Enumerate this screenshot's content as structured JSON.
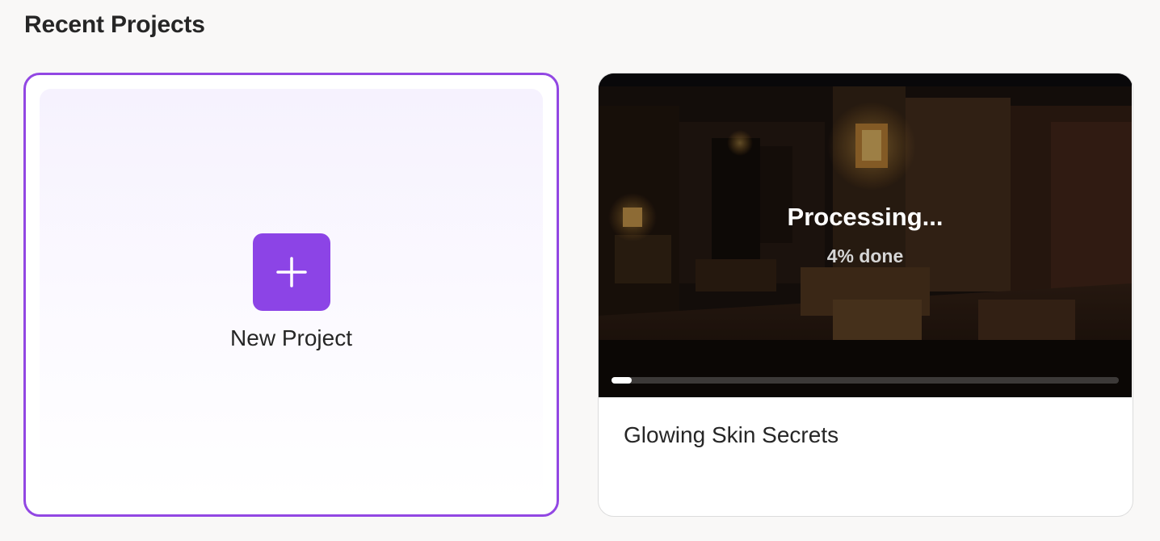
{
  "section": {
    "title": "Recent Projects"
  },
  "new_project": {
    "label": "New Project",
    "icon": "plus-icon",
    "accent": "#8c44e6"
  },
  "projects": [
    {
      "title": "Glowing Skin Secrets",
      "status": "Processing...",
      "progress_text": "4% done",
      "progress": 0.04
    }
  ]
}
